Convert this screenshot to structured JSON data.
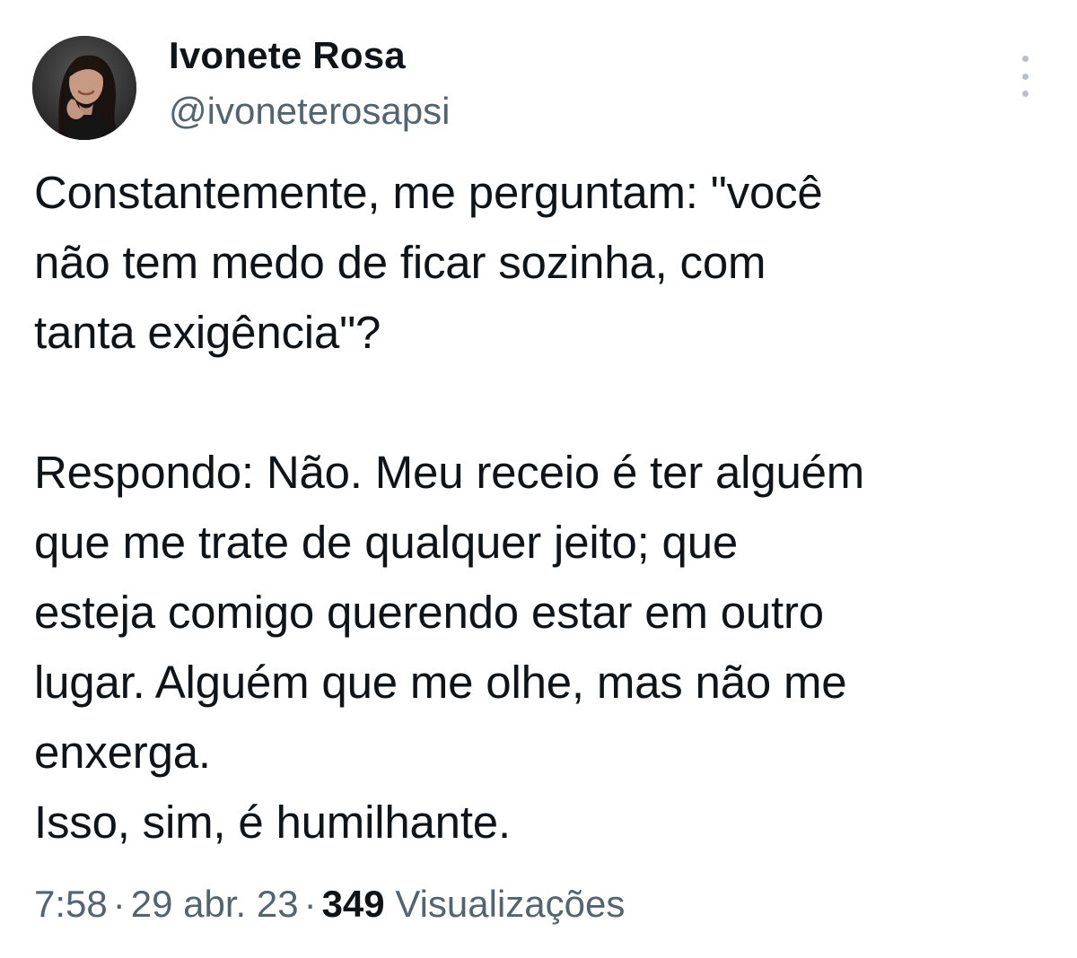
{
  "tweet": {
    "author": {
      "display_name": "Ivonete Rosa",
      "handle": "@ivoneterosapsi",
      "avatar_icon": "profile-photo"
    },
    "menu_icon": "more-vertical-icon",
    "paragraph_1": "Constantemente, me perguntam: \"você\nnão tem medo de ficar sozinha, com\ntanta exigência\"?",
    "paragraph_2": "Respondo: Não. Meu receio é ter alguém\nque me trate de qualquer jeito; que\nesteja comigo querendo estar em outro\nlugar. Alguém que me olhe, mas não me\nenxerga.\nIsso, sim, é humilhante.",
    "time": "7:58",
    "date": "29 abr. 23",
    "separator": "·",
    "views_count": "349",
    "views_label": "Visualizações"
  },
  "colors": {
    "text_primary": "#0f1419",
    "text_secondary": "#536471",
    "background": "#ffffff"
  }
}
